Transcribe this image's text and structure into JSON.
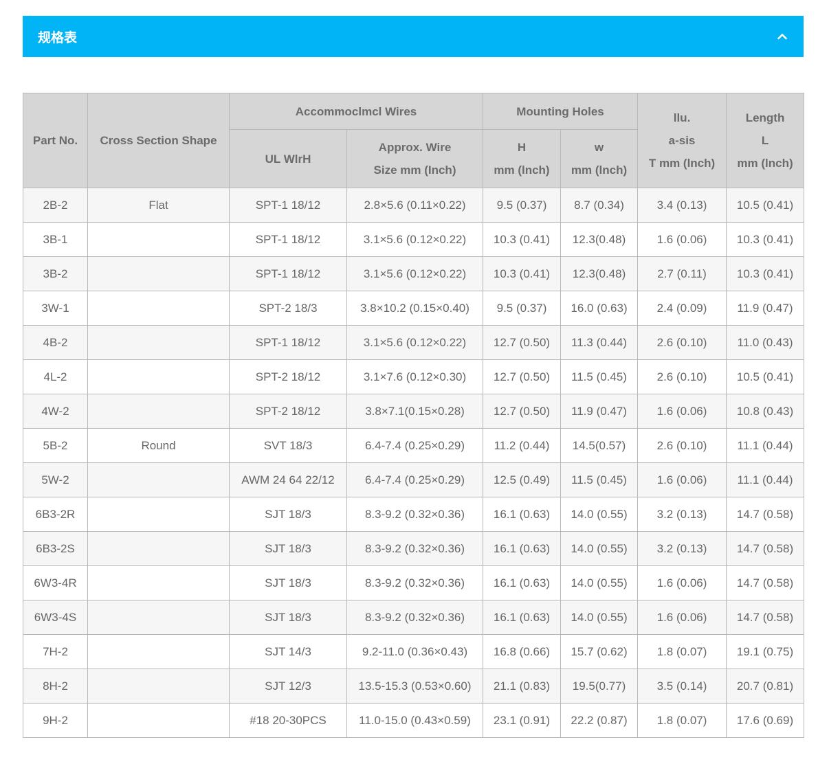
{
  "accordion": {
    "title": "规格表"
  },
  "table": {
    "headers": {
      "part_no": "Part No.",
      "cross_section_shape": "Cross Section Shape",
      "wires_group": "Accommoclmcl Wires",
      "ul_wire": "UL WlrH",
      "approx_wire_line1": "Approx. Wire",
      "approx_wire_line2": "Size mm (Inch)",
      "mounting_group": "Mounting Holes",
      "h_line1": "H",
      "h_line2": "mm (lnch)",
      "w_line1": "w",
      "w_line2": "mm (lnch)",
      "t_line1": "llu.",
      "t_line2": "a-sis",
      "t_line3": "T mm (lnch)",
      "length_line1": "Length",
      "length_line2": "L",
      "length_line3": "mm (lnch)"
    },
    "rows": [
      [
        "2B-2",
        "Flat",
        "SPT-1 18/12",
        "2.8×5.6 (0.11×0.22)",
        "9.5 (0.37)",
        "8.7 (0.34)",
        "3.4 (0.13)",
        "10.5 (0.41)"
      ],
      [
        "3B-1",
        "",
        "SPT-1 18/12",
        "3.1×5.6 (0.12×0.22)",
        "10.3 (0.41)",
        "12.3(0.48)",
        "1.6 (0.06)",
        "10.3 (0.41)"
      ],
      [
        "3B-2",
        "",
        "SPT-1 18/12",
        "3.1×5.6 (0.12×0.22)",
        "10.3 (0.41)",
        "12.3(0.48)",
        "2.7 (0.11)",
        "10.3 (0.41)"
      ],
      [
        "3W-1",
        "",
        "SPT-2 18/3",
        "3.8×10.2 (0.15×0.40)",
        "9.5 (0.37)",
        "16.0 (0.63)",
        "2.4 (0.09)",
        "11.9 (0.47)"
      ],
      [
        "4B-2",
        "",
        "SPT-1 18/12",
        "3.1×5.6 (0.12×0.22)",
        "12.7 (0.50)",
        "11.3 (0.44)",
        "2.6 (0.10)",
        "11.0 (0.43)"
      ],
      [
        "4L-2",
        "",
        "SPT-2 18/12",
        "3.1×7.6 (0.12×0.30)",
        "12.7 (0.50)",
        "11.5 (0.45)",
        "2.6 (0.10)",
        "10.5 (0.41)"
      ],
      [
        "4W-2",
        "",
        "SPT-2 18/12",
        "3.8×7.1(0.15×0.28)",
        "12.7 (0.50)",
        "11.9 (0.47)",
        "1.6 (0.06)",
        "10.8 (0.43)"
      ],
      [
        "5B-2",
        "Round",
        "SVT 18/3",
        "6.4-7.4 (0.25×0.29)",
        "11.2 (0.44)",
        "14.5(0.57)",
        "2.6 (0.10)",
        "11.1 (0.44)"
      ],
      [
        "5W-2",
        "",
        "AWM 24 64 22/12",
        "6.4-7.4 (0.25×0.29)",
        "12.5 (0.49)",
        "11.5 (0.45)",
        "1.6 (0.06)",
        "11.1 (0.44)"
      ],
      [
        "6B3-2R",
        "",
        "SJT 18/3",
        "8.3-9.2 (0.32×0.36)",
        "16.1 (0.63)",
        "14.0 (0.55)",
        "3.2 (0.13)",
        "14.7 (0.58)"
      ],
      [
        "6B3-2S",
        "",
        "SJT 18/3",
        "8.3-9.2 (0.32×0.36)",
        "16.1 (0.63)",
        "14.0 (0.55)",
        "3.2 (0.13)",
        "14.7 (0.58)"
      ],
      [
        "6W3-4R",
        "",
        "SJT 18/3",
        "8.3-9.2 (0.32×0.36)",
        "16.1 (0.63)",
        "14.0 (0.55)",
        "1.6 (0.06)",
        "14.7 (0.58)"
      ],
      [
        "6W3-4S",
        "",
        "SJT 18/3",
        "8.3-9.2 (0.32×0.36)",
        "16.1 (0.63)",
        "14.0 (0.55)",
        "1.6 (0.06)",
        "14.7 (0.58)"
      ],
      [
        "7H-2",
        "",
        "SJT 14/3",
        "9.2-11.0 (0.36×0.43)",
        "16.8 (0.66)",
        "15.7 (0.62)",
        "1.8 (0.07)",
        "19.1 (0.75)"
      ],
      [
        "8H-2",
        "",
        "SJT 12/3",
        "13.5-15.3 (0.53×0.60)",
        "21.1 (0.83)",
        "19.5(0.77)",
        "3.5 (0.14)",
        "20.7 (0.81)"
      ],
      [
        "9H-2",
        "",
        "#18 20-30PCS",
        "11.0-15.0 (0.43×0.59)",
        "23.1 (0.91)",
        "22.2 (0.87)",
        "1.8 (0.07)",
        "17.6 (0.69)"
      ]
    ]
  }
}
